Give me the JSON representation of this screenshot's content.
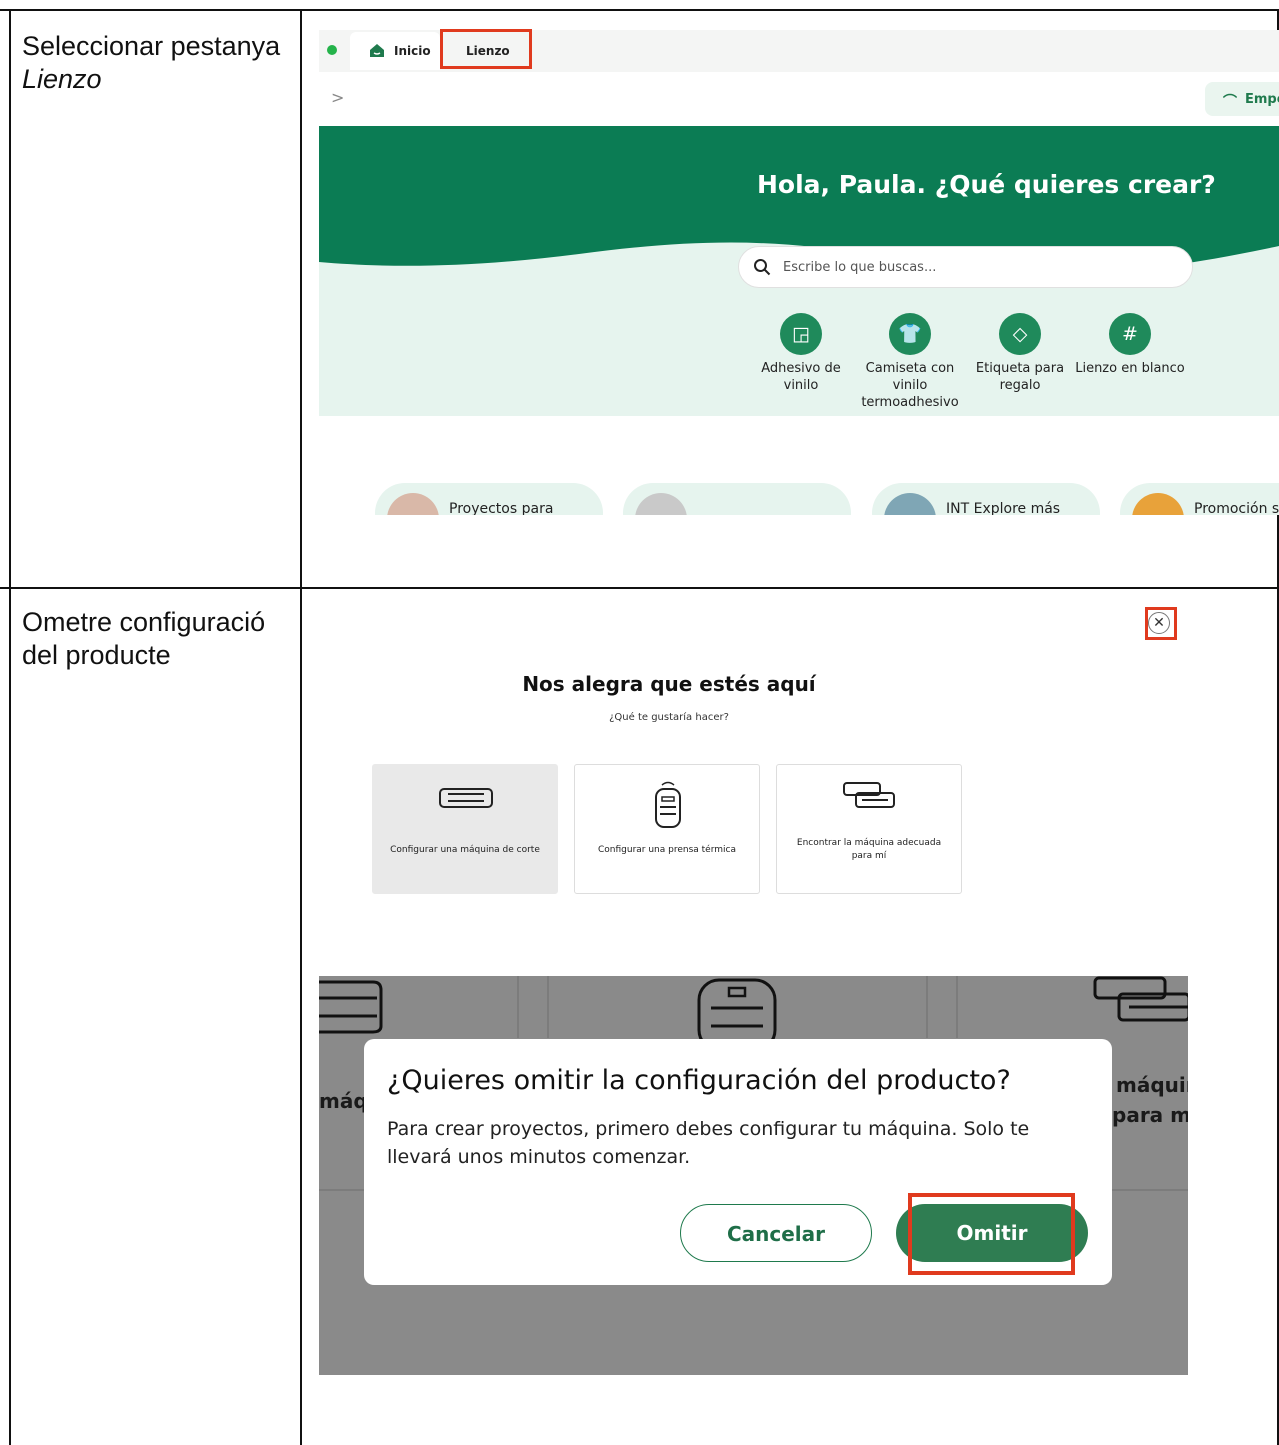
{
  "rows": [
    {
      "label_plain": "Seleccionar pestanya ",
      "label_italic": "Lienzo"
    },
    {
      "label_plain": "Ometre configuració del producte"
    }
  ],
  "shot1": {
    "tabs": {
      "home": "Inicio",
      "canvas": "Lienzo"
    },
    "toolbar_button": "Empe",
    "hero_title": "Hola, Paula. ¿Qué quieres crear?",
    "search_placeholder": "Escribe lo que buscas...",
    "quick_actions": [
      {
        "label": "Adhesivo de vinilo",
        "icon": "sticker-icon"
      },
      {
        "label": "Camiseta con vinilo termoadhesivo",
        "icon": "tshirt-icon"
      },
      {
        "label": "Etiqueta para regalo",
        "icon": "tag-icon"
      },
      {
        "label": "Lienzo en blanco",
        "icon": "hash-icon"
      }
    ],
    "pills": [
      {
        "label": "Proyectos para"
      },
      {
        "label": ""
      },
      {
        "label": "INT Explore más"
      },
      {
        "label": "Promoción s"
      }
    ]
  },
  "shot2": {
    "title": "Nos alegra que estés aquí",
    "subtitle": "¿Qué te gustaría hacer?",
    "cards": [
      {
        "label": "Configurar una máquina de corte"
      },
      {
        "label": "Configurar una prensa térmica"
      },
      {
        "label": "Encontrar la máquina adecuada para mí"
      }
    ]
  },
  "shot3": {
    "background_fragments": {
      "left": "máq",
      "right1": "máquin",
      "right2": "para mí"
    },
    "modal_title": "¿Quieres omitir la configuración del producto?",
    "modal_body": "Para crear proyectos, primero debes configurar tu máquina. Solo te llevará unos minutos comenzar.",
    "cancel_label": "Cancelar",
    "omit_label": "Omitir"
  },
  "colors": {
    "brand_green": "#1f7a4d",
    "highlight_red": "#e03a1e",
    "overlay_gray": "#8a8a8a"
  }
}
